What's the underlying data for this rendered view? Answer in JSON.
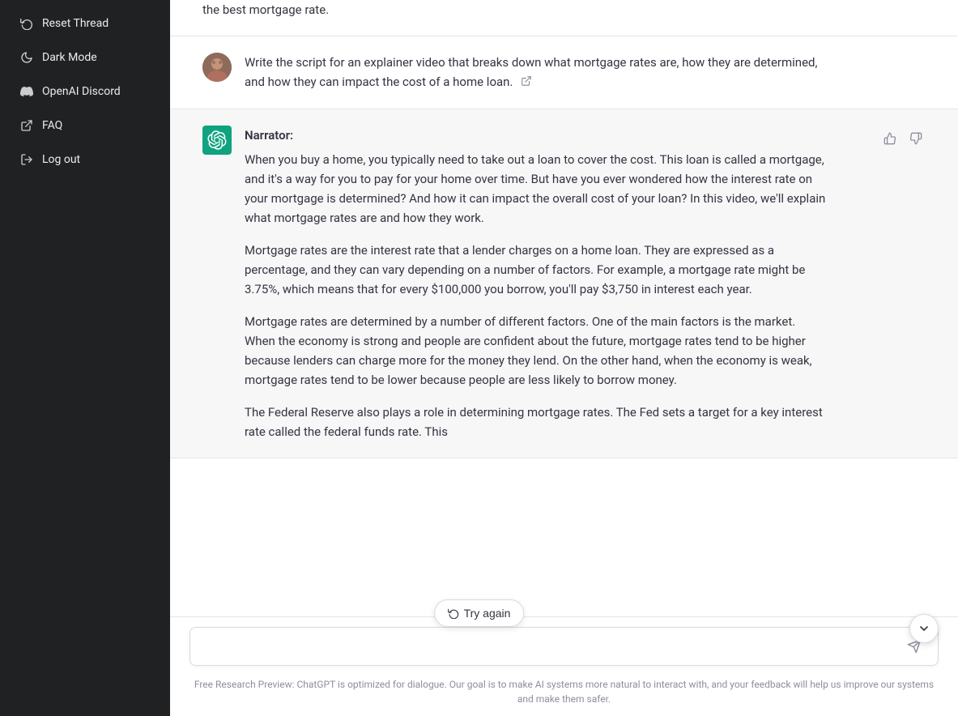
{
  "sidebar": {
    "items": [
      {
        "id": "reset-thread",
        "label": "Reset Thread",
        "icon": "reset"
      },
      {
        "id": "dark-mode",
        "label": "Dark Mode",
        "icon": "moon"
      },
      {
        "id": "openai-discord",
        "label": "OpenAI Discord",
        "icon": "discord"
      },
      {
        "id": "faq",
        "label": "FAQ",
        "icon": "external-link"
      },
      {
        "id": "log-out",
        "label": "Log out",
        "icon": "arrow-right"
      }
    ]
  },
  "chat": {
    "partial_top": "the best mortgage rate.",
    "messages": [
      {
        "id": "user-1",
        "type": "user",
        "text": "Write the script for an explainer video that breaks down what mortgage rates are, how they are determined, and how they can impact the cost of a home loan."
      },
      {
        "id": "ai-1",
        "type": "ai",
        "narrator": "Narrator:",
        "paragraphs": [
          "When you buy a home, you typically need to take out a loan to cover the cost. This loan is called a mortgage, and it's a way for you to pay for your home over time. But have you ever wondered how the interest rate on your mortgage is determined? And how it can impact the overall cost of your loan? In this video, we'll explain what mortgage rates are and how they work.",
          "Mortgage rates are the interest rate that a lender charges on a home loan. They are expressed as a percentage, and they can vary depending on a number of factors. For example, a mortgage rate might be 3.75%, which means that for every $100,000 you borrow, you'll pay $3,750 in interest each year.",
          "Mortgage rates are determined by a number of different factors. One of the main factors is the market. When the economy is strong and people are confident about the future, mortgage rates tend to be higher because lenders can charge more for the money they lend. On the other hand, when the economy is weak, mortgage rates tend to be lower because people are less likely to borrow money.",
          "The Federal Reserve also plays a role in determining mortgage rates. The Fed sets a target for a key interest rate called the federal funds rate. This"
        ]
      }
    ],
    "try_again_label": "Try again",
    "input_placeholder": "",
    "footer_text": "Free Research Preview: ChatGPT is optimized for dialogue. Our goal is to make AI systems more natural to interact with, and your feedback will help us improve our systems and make them safer."
  },
  "icons": {
    "reset": "↺",
    "moon": "☽",
    "discord": "♟",
    "external-link": "↗",
    "arrow-right": "→",
    "thumbup": "👍",
    "thumbdown": "👎",
    "send": "➤",
    "chevron-down": "↓",
    "try-again": "↺",
    "ext-link": "⧉"
  }
}
